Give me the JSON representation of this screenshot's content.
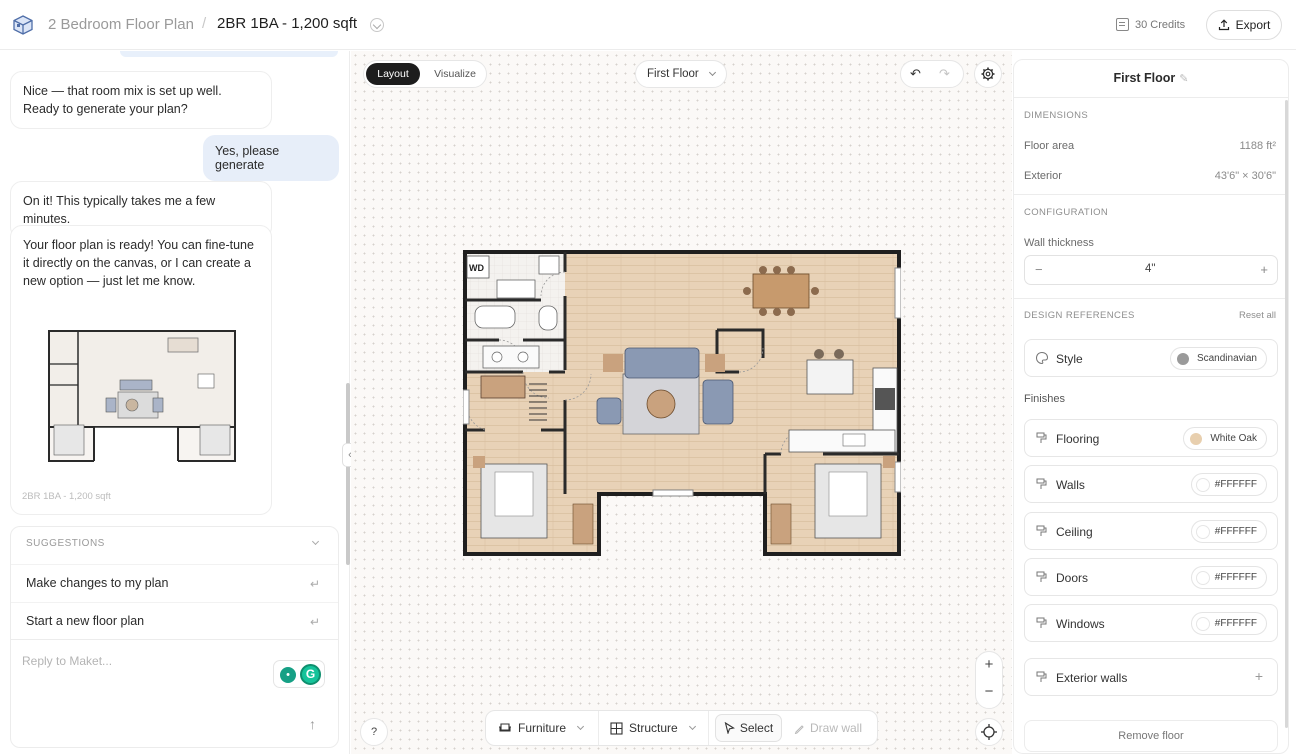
{
  "header": {
    "project_title": "2 Bedroom Floor Plan",
    "plan_title": "2BR 1BA - 1,200 sqft",
    "credits": "30 Credits",
    "export_label": "Export"
  },
  "chat": {
    "messages": [
      {
        "role": "bot",
        "text": "Nice — that room mix is set up well. Ready to generate your plan?"
      },
      {
        "role": "user",
        "text": "Yes, please generate"
      },
      {
        "role": "bot",
        "text": "On it! This typically takes me a few minutes."
      },
      {
        "role": "bot",
        "text": "Your floor plan is ready! You can fine-tune it directly on the canvas, or I can create a new option — just let me know."
      }
    ],
    "thumbnail_caption": "2BR 1BA - 1,200 sqft",
    "suggestions_header": "SUGGESTIONS",
    "suggestions": [
      "Make changes to my plan",
      "Start a new floor plan"
    ],
    "reply_placeholder": "Reply to Maket..."
  },
  "canvas": {
    "mode_tabs": [
      "Layout",
      "Visualize"
    ],
    "active_mode": "Layout",
    "floor_selector": "First Floor",
    "toolbar": {
      "furniture": "Furniture",
      "structure": "Structure",
      "select": "Select",
      "draw_wall": "Draw wall"
    },
    "help": "?",
    "plan_labels": {
      "laundry": "WD"
    }
  },
  "panel": {
    "title": "First Floor",
    "dimensions_header": "DIMENSIONS",
    "floor_area_label": "Floor area",
    "floor_area_value": "1188 ft²",
    "exterior_label": "Exterior",
    "exterior_value": "43'6\" × 30'6\"",
    "configuration_header": "CONFIGURATION",
    "wall_thickness_label": "Wall thickness",
    "wall_thickness_value": "4\"",
    "design_refs_header": "DESIGN REFERENCES",
    "reset_all": "Reset all",
    "style_label": "Style",
    "style_value": "Scandinavian",
    "finishes_label": "Finishes",
    "finishes": [
      {
        "label": "Flooring",
        "value": "White Oak",
        "swatch": "#e8cfae"
      },
      {
        "label": "Walls",
        "value": "#FFFFFF"
      },
      {
        "label": "Ceiling",
        "value": "#FFFFFF"
      },
      {
        "label": "Doors",
        "value": "#FFFFFF"
      },
      {
        "label": "Windows",
        "value": "#FFFFFF"
      }
    ],
    "exterior_walls_label": "Exterior walls",
    "remove_floor": "Remove floor"
  },
  "colors": {
    "accent_dark": "#1d1d1d",
    "user_bubble": "#e7eef9",
    "floor_wood": "#e8d2b7",
    "sofa_blue": "#8a99b3"
  }
}
